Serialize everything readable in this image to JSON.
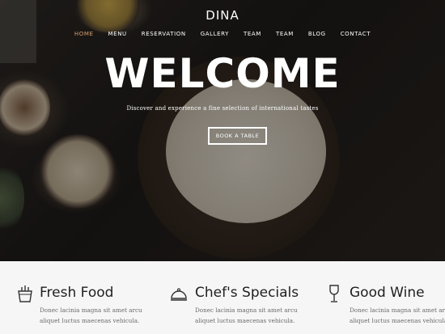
{
  "brand": "DINA",
  "nav": {
    "items": [
      "HOME",
      "MENU",
      "RESERVATION",
      "GALLERY",
      "TEAM",
      "TEAM",
      "BLOG",
      "CONTACT"
    ],
    "active": "HOME"
  },
  "hero": {
    "title": "WELCOME",
    "tagline": "Discover and experience a fine selection of international tastes",
    "cta_label": "BOOK A TABLE"
  },
  "features": [
    {
      "icon": "basket-icon",
      "title": "Fresh Food",
      "line1": "Donec lacinia magna sit amet arcu",
      "line2": "aliquet luctus maecenas vehicula."
    },
    {
      "icon": "cloche-icon",
      "title": "Chef's Specials",
      "line1": "Donec lacinia magna sit amet arcu",
      "line2": "aliquet luctus maecenas vehicula."
    },
    {
      "icon": "wine-glass-icon",
      "title": "Good Wine",
      "line1": "Donec lacinia magna sit amet arcu",
      "line2": "aliquet luctus maecenas vehicula."
    }
  ],
  "colors": {
    "accent": "#d9a06b",
    "hero_text": "#ffffff",
    "feature_bg": "#f6f6f6",
    "feature_title": "#1f1f1f",
    "feature_text": "#6a6a6a"
  }
}
